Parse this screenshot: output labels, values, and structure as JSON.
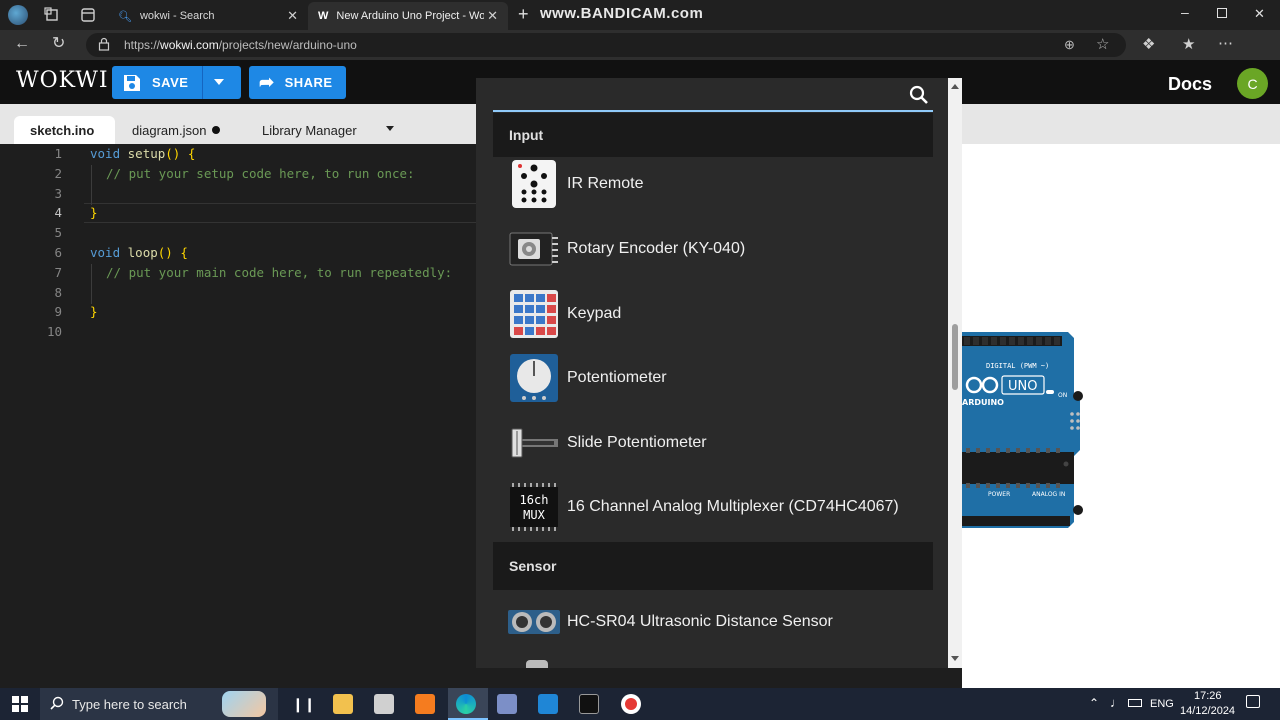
{
  "browser": {
    "tabs": [
      {
        "label": "wokwi - Search",
        "icon": "search-icon"
      },
      {
        "label": "New Arduino Uno Project - Wokw",
        "icon": "wokwi-icon"
      }
    ],
    "watermark": "www.BANDICAM.com",
    "url": "https://wokwi.com/projects/new/arduino-uno",
    "url_prefix": "https://",
    "url_domain": "wokwi.com",
    "url_path": "/projects/new/arduino-uno"
  },
  "header": {
    "logo": "WOKWI",
    "save_label": "SAVE",
    "share_label": "SHARE",
    "docs_label": "Docs",
    "avatar_initial": "C"
  },
  "editor": {
    "tabs": [
      {
        "label": "sketch.ino",
        "active": true
      },
      {
        "label": "diagram.json",
        "modified": true
      },
      {
        "label": "Library Manager"
      }
    ],
    "line_numbers": [
      "1",
      "2",
      "3",
      "4",
      "5",
      "6",
      "7",
      "8",
      "9",
      "10"
    ],
    "code": {
      "l1_kw": "void",
      "l1_fn": "setup",
      "l1_rest": "() {",
      "l2": "// put your setup code here, to run once:",
      "l4": "}",
      "l6_kw": "void",
      "l6_fn": "loop",
      "l6_rest": "() {",
      "l7": "// put your main code here, to run repeatedly:",
      "l9": "}"
    }
  },
  "popup": {
    "categories": [
      "Input",
      "Sensor"
    ],
    "parts": [
      "IR Remote",
      "Rotary Encoder (KY-040)",
      "Keypad",
      "Potentiometer",
      "Slide Potentiometer",
      "16 Channel Analog Multiplexer (CD74HC4067)",
      "HC-SR04 Ultrasonic Distance Sensor"
    ],
    "mux_label_top": "16ch",
    "mux_label_bottom": "MUX"
  },
  "board": {
    "label_uno": "UNO",
    "label_arduino": "ARDUINO",
    "label_digital": "DIGITAL (PWM ~)",
    "label_on": "ON",
    "label_power": "POWER",
    "label_analog": "ANALOG IN"
  },
  "taskbar": {
    "search_placeholder": "Type here to search",
    "lang": "ENG",
    "time": "17:26",
    "date": "14/12/2024"
  },
  "colors": {
    "accent_blue": "#1e88e5",
    "arduino_teal": "#1f6fa6",
    "avatar_green": "#6aa625"
  }
}
